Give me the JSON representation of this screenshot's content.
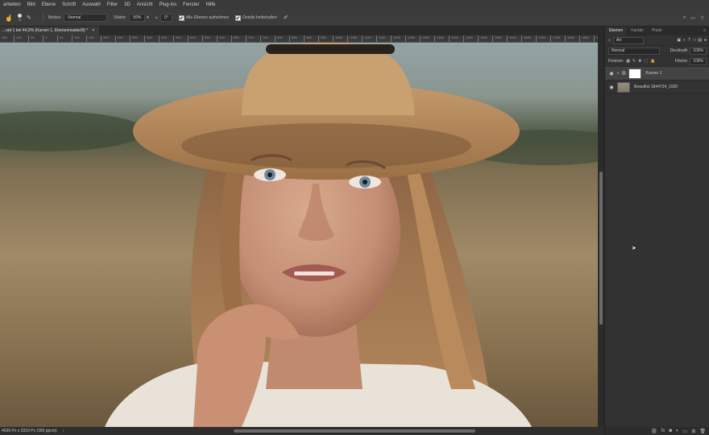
{
  "menubar": {
    "items": [
      "arbeiten",
      "Bild",
      "Ebene",
      "Schrift",
      "Auswahl",
      "Filter",
      "3D",
      "Ansicht",
      "Plug-ins",
      "Fenster",
      "Hilfe"
    ]
  },
  "options": {
    "brush_size": "71",
    "mode_label": "Modus:",
    "mode_value": "Normal",
    "strength_label": "Stärke:",
    "strength_value": "50%",
    "angle_value": "0°",
    "sample_all_label": "Alle Ebenen aufnehmen",
    "detail_label": "Details beibehalten"
  },
  "document": {
    "tab_title": "…rait-1 bei 44,9% (Kurven 1, Ebenenmaske/8) *",
    "status_text": "4636 Px x 3319 Px (300 ppcm)"
  },
  "ruler": {
    "labels": [
      "150",
      "100",
      "50",
      "0",
      "50",
      "100",
      "150",
      "200",
      "250",
      "300",
      "350",
      "400",
      "450",
      "500",
      "550",
      "600",
      "650",
      "700",
      "750",
      "800",
      "850",
      "900",
      "950",
      "1000",
      "1050",
      "1100",
      "1150",
      "1200",
      "1250",
      "1300",
      "1350",
      "1400",
      "1450",
      "1500",
      "1550",
      "1600",
      "1650",
      "1700",
      "1750",
      "1800",
      "1850",
      "1900",
      "1950",
      "2000"
    ]
  },
  "layers_panel": {
    "tabs": [
      "Ebenen",
      "Kanäle",
      "Pfade"
    ],
    "active_tab": "Ebenen",
    "filter_label": "Art",
    "blend_mode": "Normal",
    "opacity_label": "Deckkraft:",
    "opacity_value": "100%",
    "lock_label": "Fixieren:",
    "fill_label": "Fläche:",
    "fill_value": "100%",
    "layers": [
      {
        "name": "Kurven 1",
        "selected": true
      },
      {
        "name": "Beautiful 1844724_1920",
        "selected": false
      }
    ]
  },
  "colors": {
    "app_bg": "#282828",
    "panel_bg": "#323232",
    "selected_layer": "#434343"
  }
}
